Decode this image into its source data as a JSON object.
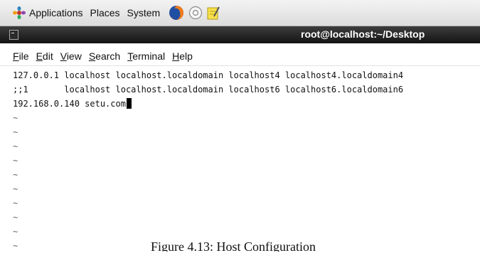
{
  "top_panel": {
    "menus": [
      "Applications",
      "Places",
      "System"
    ],
    "launchers": [
      "firefox-icon",
      "help-icon",
      "notes-icon"
    ]
  },
  "window": {
    "title": "root@localhost:~/Desktop",
    "menus": [
      {
        "underline": "F",
        "rest": "ile"
      },
      {
        "underline": "E",
        "rest": "dit"
      },
      {
        "underline": "V",
        "rest": "iew"
      },
      {
        "underline": "S",
        "rest": "earch"
      },
      {
        "underline": "T",
        "rest": "erminal"
      },
      {
        "underline": "H",
        "rest": "elp"
      }
    ]
  },
  "terminal": {
    "lines": [
      "127.0.0.1 localhost localhost.localdomain localhost4 localhost4.localdomain4",
      ";;1       localhost localhost.localdomain localhost6 localhost6.localdomain6",
      "192.168.0.140 setu.com"
    ],
    "tilde": "~"
  },
  "caption": "Figure 4.13: Host Configuration"
}
